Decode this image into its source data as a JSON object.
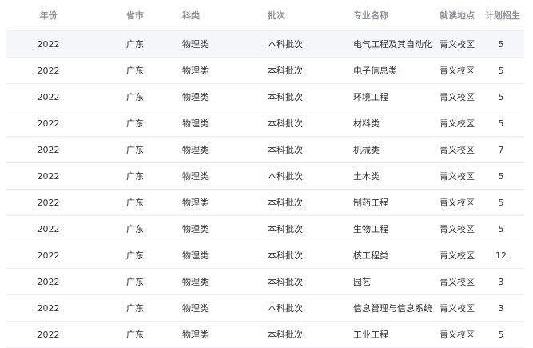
{
  "table": {
    "headers": {
      "year": "年份",
      "province": "省市",
      "category": "科类",
      "batch": "批次",
      "major": "专业名称",
      "campus": "就读地点",
      "plan": "计划招生"
    },
    "rows": [
      {
        "year": "2022",
        "province": "广东",
        "category": "物理类",
        "batch": "本科批次",
        "major": "电气工程及其自动化",
        "campus": "青义校区",
        "plan": "5"
      },
      {
        "year": "2022",
        "province": "广东",
        "category": "物理类",
        "batch": "本科批次",
        "major": "电子信息类",
        "campus": "青义校区",
        "plan": "5"
      },
      {
        "year": "2022",
        "province": "广东",
        "category": "物理类",
        "batch": "本科批次",
        "major": "环境工程",
        "campus": "青义校区",
        "plan": "5"
      },
      {
        "year": "2022",
        "province": "广东",
        "category": "物理类",
        "batch": "本科批次",
        "major": "材料类",
        "campus": "青义校区",
        "plan": "5"
      },
      {
        "year": "2022",
        "province": "广东",
        "category": "物理类",
        "batch": "本科批次",
        "major": "机械类",
        "campus": "青义校区",
        "plan": "7"
      },
      {
        "year": "2022",
        "province": "广东",
        "category": "物理类",
        "batch": "本科批次",
        "major": "土木类",
        "campus": "青义校区",
        "plan": "5"
      },
      {
        "year": "2022",
        "province": "广东",
        "category": "物理类",
        "batch": "本科批次",
        "major": "制药工程",
        "campus": "青义校区",
        "plan": "5"
      },
      {
        "year": "2022",
        "province": "广东",
        "category": "物理类",
        "batch": "本科批次",
        "major": "生物工程",
        "campus": "青义校区",
        "plan": "5"
      },
      {
        "year": "2022",
        "province": "广东",
        "category": "物理类",
        "batch": "本科批次",
        "major": "核工程类",
        "campus": "青义校区",
        "plan": "12"
      },
      {
        "year": "2022",
        "province": "广东",
        "category": "物理类",
        "batch": "本科批次",
        "major": "园艺",
        "campus": "青义校区",
        "plan": "3"
      },
      {
        "year": "2022",
        "province": "广东",
        "category": "物理类",
        "batch": "本科批次",
        "major": "信息管理与信息系统",
        "campus": "青义校区",
        "plan": "3"
      },
      {
        "year": "2022",
        "province": "广东",
        "category": "物理类",
        "batch": "本科批次",
        "major": "工业工程",
        "campus": "青义校区",
        "plan": "5"
      }
    ]
  }
}
